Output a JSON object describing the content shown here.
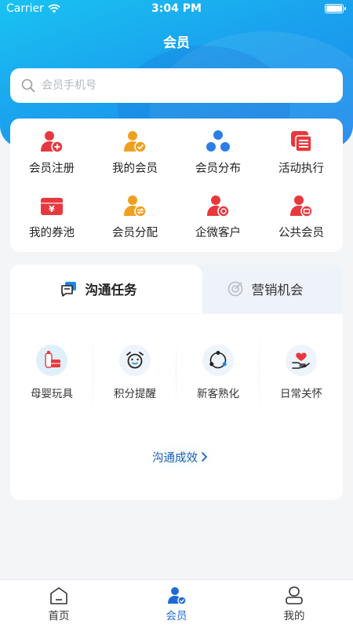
{
  "status_bar": {
    "carrier": "Carrier",
    "time": "3:04 PM"
  },
  "header": {
    "title": "会员"
  },
  "search": {
    "placeholder": "会员手机号"
  },
  "grid": {
    "items": [
      {
        "label": "会员注册",
        "icon": "member-add-icon"
      },
      {
        "label": "我的会员",
        "icon": "my-member-icon"
      },
      {
        "label": "会员分布",
        "icon": "distribution-icon"
      },
      {
        "label": "活动执行",
        "icon": "activity-icon"
      },
      {
        "label": "我的券池",
        "icon": "coupon-icon"
      },
      {
        "label": "会员分配",
        "icon": "assign-icon"
      },
      {
        "label": "企微客户",
        "icon": "wecom-customer-icon"
      },
      {
        "label": "公共会员",
        "icon": "public-member-icon"
      }
    ]
  },
  "tabs": {
    "active": "沟通任务",
    "inactive": "营销机会"
  },
  "tasks": {
    "items": [
      {
        "label": "母婴玩具",
        "icon": "baby-toys-icon"
      },
      {
        "label": "积分提醒",
        "icon": "alarm-clock-icon"
      },
      {
        "label": "新客熟化",
        "icon": "cycle-icon"
      },
      {
        "label": "日常关怀",
        "icon": "heart-hand-icon"
      }
    ],
    "effect_link": "沟通成效"
  },
  "tabbar": {
    "items": [
      {
        "label": "首页",
        "icon": "home-icon"
      },
      {
        "label": "会员",
        "icon": "member-icon"
      },
      {
        "label": "我的",
        "icon": "profile-icon"
      }
    ],
    "active_index": 1
  },
  "colors": {
    "brand_blue": "#1d86ea",
    "hero_light": "#19c3f2",
    "icon_red": "#e8383d",
    "icon_orange": "#f0a020",
    "icon_blue": "#2b7de9",
    "link_blue": "#1e63b8"
  }
}
